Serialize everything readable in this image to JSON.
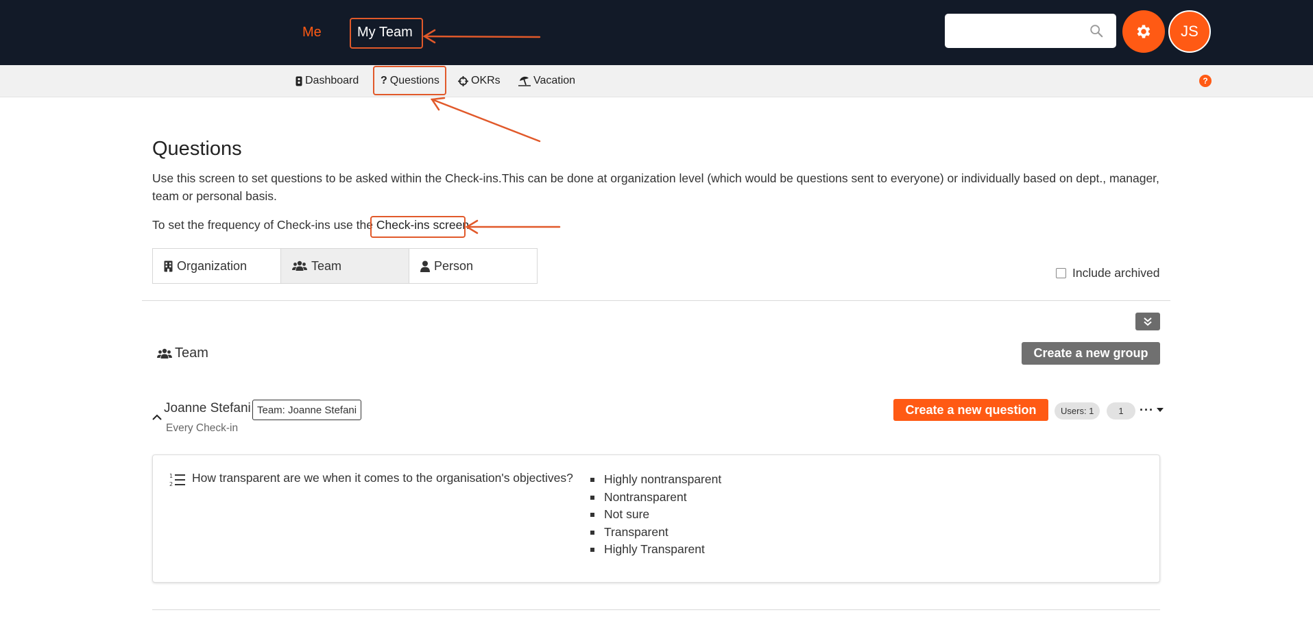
{
  "topnav": {
    "me_label": "Me",
    "my_team_label": "My Team",
    "search": {
      "placeholder": "",
      "icon": "search-icon"
    },
    "settings_icon": "gear-icon",
    "avatar_initials": "JS",
    "accent_color": "#ff5a14",
    "bar_color": "#121a28"
  },
  "subnav": {
    "items": [
      {
        "label": "Dashboard",
        "icon": "dashboard-icon"
      },
      {
        "label": "Questions",
        "icon": "question-mark-icon"
      },
      {
        "label": "OKRs",
        "icon": "crosshair-icon"
      },
      {
        "label": "Vacation",
        "icon": "beach-umbrella-icon"
      }
    ],
    "help_label": "?"
  },
  "page": {
    "title": "Questions",
    "description": "Use this screen to set questions to be asked within the Check-ins.This can be done at organization level (which would be questions sent to everyone) or individually based on dept., manager, team or personal basis.",
    "frequency_prefix": "To set the frequency of Check-ins use the",
    "checkins_link": "Check-ins screen"
  },
  "tabs": [
    {
      "label": "Organization",
      "icon": "building-icon",
      "active": false
    },
    {
      "label": "Team",
      "icon": "users-icon",
      "active": true
    },
    {
      "label": "Person",
      "icon": "user-icon",
      "active": false
    }
  ],
  "include_archived_label": "Include archived",
  "section": {
    "heading": "Team",
    "create_group_label": "Create a new group"
  },
  "group": {
    "person_name": "Joanne Stefani",
    "team_badge": "Team: Joanne Stefani",
    "schedule": "Every Check-in",
    "create_question_label": "Create a new question",
    "users_label": "Users: 1",
    "count_label": "1",
    "more_label": "···"
  },
  "question": {
    "text": "How transparent are we when it comes to the organisation's objectives?",
    "icon": "ordered-list-icon",
    "answers": [
      "Highly nontransparent",
      "Nontransparent",
      "Not sure",
      "Transparent",
      "Highly Transparent"
    ]
  },
  "annotation_color": "#e1592a"
}
